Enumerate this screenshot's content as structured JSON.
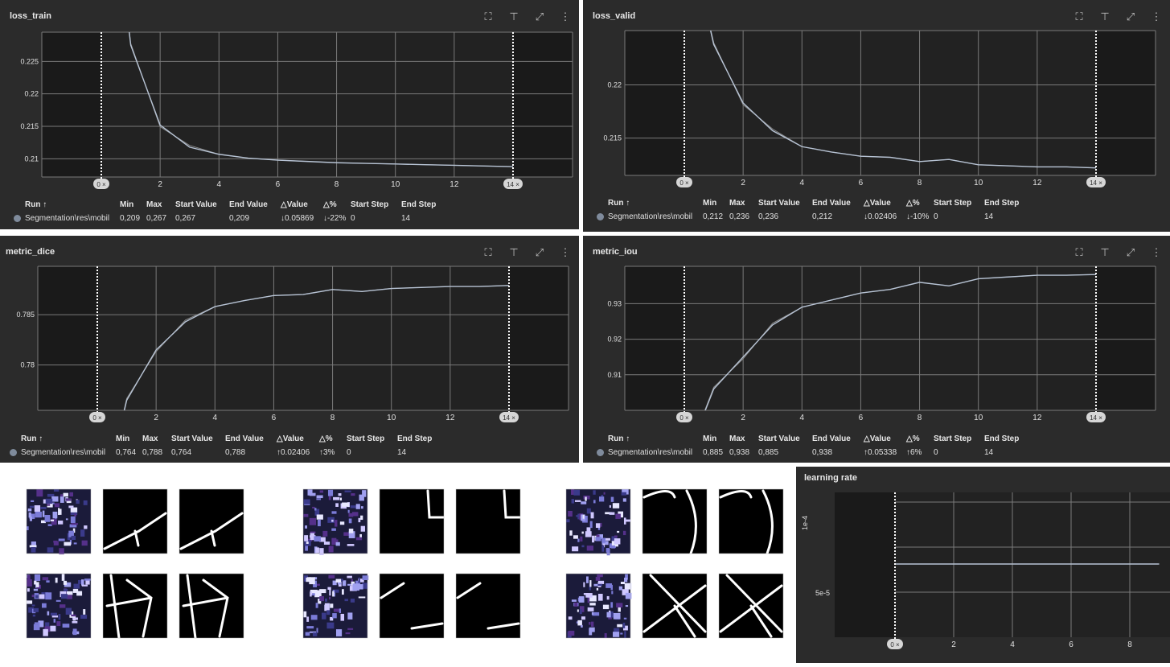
{
  "table_headers": [
    "Run ↑",
    "Min",
    "Max",
    "Start Value",
    "End Value",
    "△Value",
    "△%",
    "Start Step",
    "End Step"
  ],
  "run_name": "Segmentation\\res\\mobil",
  "range_start": "0 ×",
  "range_end": "14 ×",
  "colors": {
    "card_bg": "#2b2b2b",
    "plot_bg": "#222222",
    "shade": "#1a1a1a",
    "grid": "#7a7a7a",
    "line": "#b7c3d4",
    "line2": "#8a8a8a"
  },
  "charts": [
    {
      "title": "loss_train",
      "stats": [
        "0,209",
        "0,267",
        "0,267",
        "0,209",
        "↓0.05869",
        "↓-22%",
        "0",
        "14"
      ],
      "chart_data": {
        "type": "line",
        "title": "loss_train",
        "x": [
          0,
          1,
          2,
          3,
          4,
          5,
          6,
          7,
          8,
          9,
          10,
          11,
          12,
          13,
          14
        ],
        "series": [
          {
            "name": "Segmentation\\res\\mobil",
            "values": [
              0.267,
              0.2275,
              0.2152,
              0.2118,
              0.2107,
              0.2101,
              0.2098,
              0.2096,
              0.2094,
              0.2093,
              0.2092,
              0.2091,
              0.209,
              0.2089,
              0.2088
            ]
          }
        ],
        "xticks": [
          "2",
          "4",
          "6",
          "8",
          "10",
          "12"
        ],
        "yticks": [
          "0.21",
          "0.215",
          "0.22",
          "0.225"
        ],
        "xlim": [
          -2,
          16
        ],
        "ylim": [
          0.2072,
          0.2295
        ],
        "grid": true
      }
    },
    {
      "title": "loss_valid",
      "stats": [
        "0,212",
        "0,236",
        "0,236",
        "0,212",
        "↓0.02406",
        "↓-10%",
        "0",
        "14"
      ],
      "chart_data": {
        "type": "line",
        "title": "loss_valid",
        "x": [
          0,
          1,
          2,
          3,
          4,
          5,
          6,
          7,
          8,
          9,
          10,
          11,
          12,
          13,
          14
        ],
        "series": [
          {
            "name": "Segmentation\\res\\mobil",
            "values": [
              0.236,
              0.2238,
              0.2183,
              0.2157,
              0.2142,
              0.2137,
              0.2133,
              0.2132,
              0.2128,
              0.213,
              0.2125,
              0.2124,
              0.2123,
              0.2123,
              0.2122
            ]
          }
        ],
        "xticks": [
          "2",
          "4",
          "6",
          "8",
          "10",
          "12"
        ],
        "yticks": [
          "0.215",
          "0.22"
        ],
        "xlim": [
          -2,
          16
        ],
        "ylim": [
          0.2115,
          0.2251
        ],
        "grid": true
      }
    },
    {
      "title": "metric_dice",
      "stats": [
        "0,764",
        "0,788",
        "0,764",
        "0,788",
        "↑0.02406",
        "↑3%",
        "0",
        "14"
      ],
      "chart_data": {
        "type": "line",
        "title": "metric_dice",
        "x": [
          0,
          1,
          2,
          3,
          4,
          5,
          6,
          7,
          8,
          9,
          10,
          11,
          12,
          13,
          14
        ],
        "series": [
          {
            "name": "Segmentation\\res\\mobil",
            "values": [
              0.764,
              0.7765,
              0.7815,
              0.7843,
              0.7858,
              0.7864,
              0.7869,
              0.787,
              0.7875,
              0.7873,
              0.7876,
              0.7877,
              0.7878,
              0.7878,
              0.7879
            ]
          }
        ],
        "xticks": [
          "2",
          "4",
          "6",
          "8",
          "10",
          "12"
        ],
        "yticks": [
          "0.78",
          "0.785"
        ],
        "xlim": [
          -2,
          16
        ],
        "ylim": [
          0.7755,
          0.7898
        ],
        "grid": true
      }
    },
    {
      "title": "metric_iou",
      "stats": [
        "0,885",
        "0,938",
        "0,885",
        "0,938",
        "↑0.05338",
        "↑6%",
        "0",
        "14"
      ],
      "chart_data": {
        "type": "line",
        "title": "metric_iou",
        "x": [
          0,
          1,
          2,
          3,
          4,
          5,
          6,
          7,
          8,
          9,
          10,
          11,
          12,
          13,
          14
        ],
        "series": [
          {
            "name": "Segmentation\\res\\mobil",
            "values": [
              0.885,
              0.906,
              0.915,
              0.924,
              0.929,
              0.931,
              0.933,
              0.934,
              0.936,
              0.935,
              0.937,
              0.9375,
              0.938,
              0.938,
              0.9382
            ]
          }
        ],
        "xticks": [
          "2",
          "4",
          "6",
          "8",
          "10",
          "12"
        ],
        "yticks": [
          "0.91",
          "0.92",
          "0.93"
        ],
        "xlim": [
          -2,
          16
        ],
        "ylim": [
          0.9,
          0.9405
        ],
        "grid": true
      }
    }
  ],
  "learning_rate": {
    "title": "learning rate",
    "y_axis_label": "1e-4",
    "yticks": [
      "5e-5"
    ],
    "xticks": [
      "2",
      "4",
      "6",
      "8"
    ],
    "chart_data": {
      "type": "line",
      "title": "learning rate",
      "x": [
        0,
        2,
        4,
        6,
        8,
        9
      ],
      "series": [
        {
          "values": [
            8e-05,
            8e-05,
            8e-05,
            8e-05,
            8e-05,
            8e-05
          ]
        }
      ],
      "xlim": [
        -2,
        9.5
      ],
      "ylim": [
        3e-05,
        0.00012
      ],
      "grid": true
    }
  }
}
